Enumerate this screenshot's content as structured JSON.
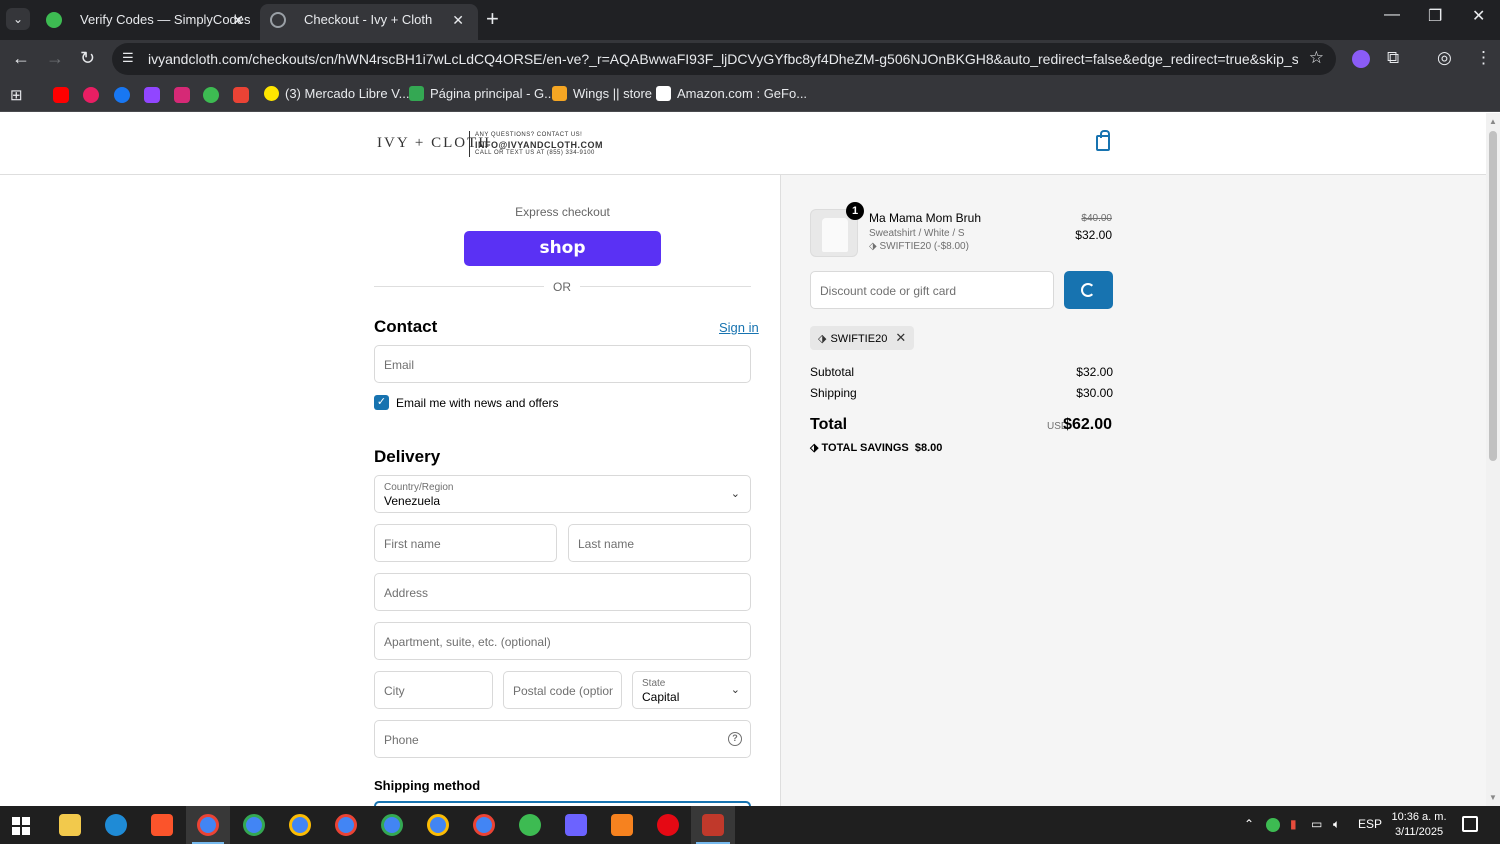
{
  "browser": {
    "tabs": [
      {
        "title": "Verify Codes — SimplyCodes",
        "active": false
      },
      {
        "title": "Checkout - Ivy + Cloth",
        "active": true
      }
    ],
    "url": "ivyandcloth.com/checkouts/cn/hWN4rscBH1i7wLcLdCQ4ORSE/en-ve?_r=AQABwwaFI93F_ljDCVyGYfbc8yf4DheZM-g506NJOnBKGH8&auto_redirect=false&edge_redirect=true&skip_shop_pay=true...",
    "bookmarks": [
      "(3) Mercado Libre V...",
      "Página principal - G...",
      "Wings || store",
      "Amazon.com : GeFo..."
    ]
  },
  "store": {
    "logo": "IVY + CLOTH",
    "tagline_top": "ANY QUESTIONS? CONTACT US!",
    "tagline_email": "INFO@IVYANDCLOTH.COM",
    "tagline_phone": "CALL OR TEXT US AT (855) 334-9100"
  },
  "checkout": {
    "express_label": "Express checkout",
    "shop_button": "shop",
    "or_label": "OR",
    "contact_heading": "Contact",
    "sign_in": "Sign in",
    "email_placeholder": "Email",
    "news_checkbox_label": "Email me with news and offers",
    "news_checked": true,
    "delivery_heading": "Delivery",
    "country_label": "Country/Region",
    "country_value": "Venezuela",
    "first_name_placeholder": "First name",
    "last_name_placeholder": "Last name",
    "address_placeholder": "Address",
    "apartment_placeholder": "Apartment, suite, etc. (optional)",
    "city_placeholder": "City",
    "postal_placeholder": "Postal code (option...",
    "state_label": "State",
    "state_value": "Capital",
    "phone_placeholder": "Phone",
    "shipping_method_heading": "Shipping method"
  },
  "summary": {
    "product_name": "Ma Mama Mom Bruh",
    "product_variant": "Sweatshirt / White / S",
    "product_discount": "SWIFTIE20 (-$8.00)",
    "quantity": "1",
    "price_original": "$40.00",
    "price_final": "$32.00",
    "discount_placeholder": "Discount code or gift card",
    "applied_code": "SWIFTIE20",
    "subtotal_label": "Subtotal",
    "subtotal_value": "$32.00",
    "shipping_label": "Shipping",
    "shipping_value": "$30.00",
    "total_label": "Total",
    "total_currency": "USD",
    "total_value": "$62.00",
    "savings_label": "TOTAL SAVINGS",
    "savings_value": "$8.00"
  },
  "taskbar": {
    "language": "ESP",
    "time": "10:36 a. m.",
    "date": "3/11/2025"
  },
  "colors": {
    "accent": "#1773b0",
    "shop_pay": "#5a31f4",
    "chrome_dark": "#202124",
    "chrome_toolbar": "#35363a"
  }
}
